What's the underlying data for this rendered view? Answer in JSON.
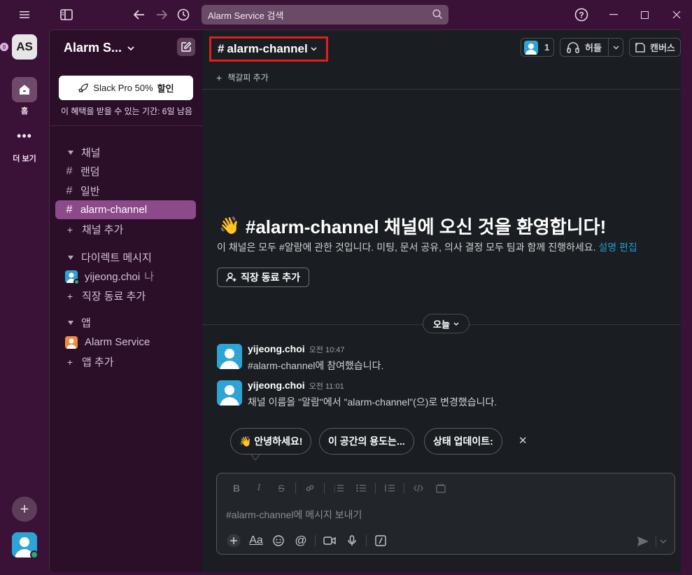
{
  "titlebar": {
    "search_text": "Alarm Service 검색",
    "icons": [
      "hamburger-icon",
      "sidebar-toggle-icon",
      "back-arrow-icon",
      "forward-arrow-icon",
      "history-icon",
      "search-icon",
      "help-icon",
      "minimize-icon",
      "maximize-icon",
      "close-icon"
    ]
  },
  "rail": {
    "workspace_initials": "AS",
    "workspace_badge": "8",
    "home_label": "홈",
    "more_label": "더 보기"
  },
  "sidebar": {
    "workspace_name": "Alarm S...",
    "promo_label_prefix": "Slack Pro 50%",
    "promo_label_bold": "할인",
    "promo_note": "이 혜택을 받을 수 있는 기간: 6일 남음",
    "channels_header": "채널",
    "channels": [
      "랜덤",
      "일반",
      "alarm-channel"
    ],
    "add_channel": "채널 추가",
    "dm_header": "다이렉트 메시지",
    "dm_user": "yijeong.choi",
    "dm_you": "나",
    "add_coworker": "직장 동료 추가",
    "apps_header": "앱",
    "app_name": "Alarm Service",
    "add_app": "앱 추가"
  },
  "header": {
    "channel_name": "alarm-channel",
    "member_count": "1",
    "huddle_label": "허들",
    "canvas_label": "캔버스",
    "bookmark_label": "책갈피 추가"
  },
  "welcome": {
    "title": "#alarm-channel 채널에 오신 것을 환영합니다!",
    "description": "이 채널은 모두 #알람에 관한 것입니다. 미팅, 문서 공유, 의사 결정 모두 팀과 함께 진행하세요.",
    "edit_link": "설명 편집",
    "add_coworker_button": "직장 동료 추가"
  },
  "date_divider": "오늘",
  "messages": [
    {
      "author": "yijeong.choi",
      "time": "오전 10:47",
      "text": "#alarm-channel에 참여했습니다."
    },
    {
      "author": "yijeong.choi",
      "time": "오전 11:01",
      "text": "채널 이름을 \"알람\"에서 \"alarm-channel\"(으)로 변경했습니다."
    }
  ],
  "suggestions": [
    "👋 안녕하세요!",
    "이 공간의 용도는...",
    "상태 업데이트:"
  ],
  "composer": {
    "placeholder": "#alarm-channel에 메시지 보내기"
  },
  "colors": {
    "aubergine": "#3b1237",
    "sidebar": "#2b0f29",
    "active_channel": "#8d4a8a",
    "main_bg": "#1a1d21",
    "highlight_border": "#e01e1e",
    "link": "#1d9bd1"
  }
}
